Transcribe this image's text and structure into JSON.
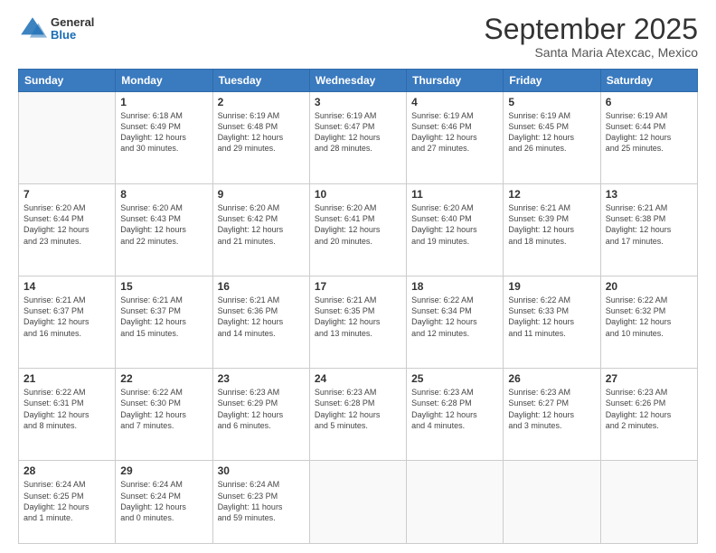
{
  "header": {
    "logo": {
      "general": "General",
      "blue": "Blue"
    },
    "month": "September 2025",
    "location": "Santa Maria Atexcac, Mexico"
  },
  "days_of_week": [
    "Sunday",
    "Monday",
    "Tuesday",
    "Wednesday",
    "Thursday",
    "Friday",
    "Saturday"
  ],
  "weeks": [
    [
      {
        "day": "",
        "info": ""
      },
      {
        "day": "1",
        "info": "Sunrise: 6:18 AM\nSunset: 6:49 PM\nDaylight: 12 hours\nand 30 minutes."
      },
      {
        "day": "2",
        "info": "Sunrise: 6:19 AM\nSunset: 6:48 PM\nDaylight: 12 hours\nand 29 minutes."
      },
      {
        "day": "3",
        "info": "Sunrise: 6:19 AM\nSunset: 6:47 PM\nDaylight: 12 hours\nand 28 minutes."
      },
      {
        "day": "4",
        "info": "Sunrise: 6:19 AM\nSunset: 6:46 PM\nDaylight: 12 hours\nand 27 minutes."
      },
      {
        "day": "5",
        "info": "Sunrise: 6:19 AM\nSunset: 6:45 PM\nDaylight: 12 hours\nand 26 minutes."
      },
      {
        "day": "6",
        "info": "Sunrise: 6:19 AM\nSunset: 6:44 PM\nDaylight: 12 hours\nand 25 minutes."
      }
    ],
    [
      {
        "day": "7",
        "info": "Sunrise: 6:20 AM\nSunset: 6:44 PM\nDaylight: 12 hours\nand 23 minutes."
      },
      {
        "day": "8",
        "info": "Sunrise: 6:20 AM\nSunset: 6:43 PM\nDaylight: 12 hours\nand 22 minutes."
      },
      {
        "day": "9",
        "info": "Sunrise: 6:20 AM\nSunset: 6:42 PM\nDaylight: 12 hours\nand 21 minutes."
      },
      {
        "day": "10",
        "info": "Sunrise: 6:20 AM\nSunset: 6:41 PM\nDaylight: 12 hours\nand 20 minutes."
      },
      {
        "day": "11",
        "info": "Sunrise: 6:20 AM\nSunset: 6:40 PM\nDaylight: 12 hours\nand 19 minutes."
      },
      {
        "day": "12",
        "info": "Sunrise: 6:21 AM\nSunset: 6:39 PM\nDaylight: 12 hours\nand 18 minutes."
      },
      {
        "day": "13",
        "info": "Sunrise: 6:21 AM\nSunset: 6:38 PM\nDaylight: 12 hours\nand 17 minutes."
      }
    ],
    [
      {
        "day": "14",
        "info": "Sunrise: 6:21 AM\nSunset: 6:37 PM\nDaylight: 12 hours\nand 16 minutes."
      },
      {
        "day": "15",
        "info": "Sunrise: 6:21 AM\nSunset: 6:37 PM\nDaylight: 12 hours\nand 15 minutes."
      },
      {
        "day": "16",
        "info": "Sunrise: 6:21 AM\nSunset: 6:36 PM\nDaylight: 12 hours\nand 14 minutes."
      },
      {
        "day": "17",
        "info": "Sunrise: 6:21 AM\nSunset: 6:35 PM\nDaylight: 12 hours\nand 13 minutes."
      },
      {
        "day": "18",
        "info": "Sunrise: 6:22 AM\nSunset: 6:34 PM\nDaylight: 12 hours\nand 12 minutes."
      },
      {
        "day": "19",
        "info": "Sunrise: 6:22 AM\nSunset: 6:33 PM\nDaylight: 12 hours\nand 11 minutes."
      },
      {
        "day": "20",
        "info": "Sunrise: 6:22 AM\nSunset: 6:32 PM\nDaylight: 12 hours\nand 10 minutes."
      }
    ],
    [
      {
        "day": "21",
        "info": "Sunrise: 6:22 AM\nSunset: 6:31 PM\nDaylight: 12 hours\nand 8 minutes."
      },
      {
        "day": "22",
        "info": "Sunrise: 6:22 AM\nSunset: 6:30 PM\nDaylight: 12 hours\nand 7 minutes."
      },
      {
        "day": "23",
        "info": "Sunrise: 6:23 AM\nSunset: 6:29 PM\nDaylight: 12 hours\nand 6 minutes."
      },
      {
        "day": "24",
        "info": "Sunrise: 6:23 AM\nSunset: 6:28 PM\nDaylight: 12 hours\nand 5 minutes."
      },
      {
        "day": "25",
        "info": "Sunrise: 6:23 AM\nSunset: 6:28 PM\nDaylight: 12 hours\nand 4 minutes."
      },
      {
        "day": "26",
        "info": "Sunrise: 6:23 AM\nSunset: 6:27 PM\nDaylight: 12 hours\nand 3 minutes."
      },
      {
        "day": "27",
        "info": "Sunrise: 6:23 AM\nSunset: 6:26 PM\nDaylight: 12 hours\nand 2 minutes."
      }
    ],
    [
      {
        "day": "28",
        "info": "Sunrise: 6:24 AM\nSunset: 6:25 PM\nDaylight: 12 hours\nand 1 minute."
      },
      {
        "day": "29",
        "info": "Sunrise: 6:24 AM\nSunset: 6:24 PM\nDaylight: 12 hours\nand 0 minutes."
      },
      {
        "day": "30",
        "info": "Sunrise: 6:24 AM\nSunset: 6:23 PM\nDaylight: 11 hours\nand 59 minutes."
      },
      {
        "day": "",
        "info": ""
      },
      {
        "day": "",
        "info": ""
      },
      {
        "day": "",
        "info": ""
      },
      {
        "day": "",
        "info": ""
      }
    ]
  ]
}
